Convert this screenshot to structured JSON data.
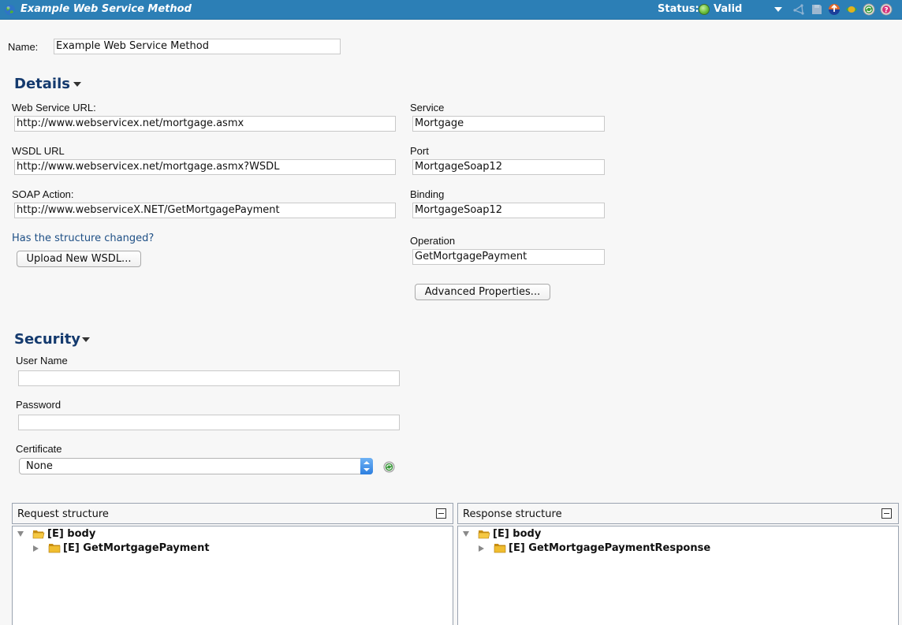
{
  "titlebar": {
    "title": "Example Web Service Method",
    "status_label": "Status:",
    "status_value": "Valid",
    "status_color": "#6cbf3c",
    "icons": [
      "globe-icon",
      "dropdown-arrow-icon",
      "share-icon",
      "save-icon",
      "deploy-icon",
      "toggle-icon",
      "refresh-icon",
      "help-icon"
    ]
  },
  "name": {
    "label": "Name:",
    "value": "Example Web Service Method"
  },
  "details": {
    "title": "Details",
    "web_service_url": {
      "label": "Web Service URL:",
      "value": "http://www.webservicex.net/mortgage.asmx"
    },
    "wsdl_url": {
      "label": "WSDL URL",
      "value": "http://www.webservicex.net/mortgage.asmx?WSDL"
    },
    "soap_action": {
      "label": "SOAP Action:",
      "value": "http://www.webserviceX.NET/GetMortgagePayment"
    },
    "structure_link": "Has the structure changed?",
    "upload_button": "Upload New WSDL...",
    "service": {
      "label": "Service",
      "value": "Mortgage"
    },
    "port": {
      "label": "Port",
      "value": "MortgageSoap12"
    },
    "binding": {
      "label": "Binding",
      "value": "MortgageSoap12"
    },
    "operation": {
      "label": "Operation",
      "value": "GetMortgagePayment"
    },
    "advanced_button": "Advanced Properties..."
  },
  "security": {
    "title": "Security",
    "user_name": {
      "label": "User Name",
      "value": ""
    },
    "password": {
      "label": "Password",
      "value": ""
    },
    "certificate": {
      "label": "Certificate",
      "selected": "None"
    }
  },
  "request": {
    "title": "Request structure",
    "tree": [
      {
        "label": "[E] body",
        "expanded": true,
        "level": 0
      },
      {
        "label": "[E] GetMortgagePayment",
        "expanded": false,
        "level": 1
      }
    ]
  },
  "response": {
    "title": "Response structure",
    "tree": [
      {
        "label": "[E] body",
        "expanded": true,
        "level": 0
      },
      {
        "label": "[E] GetMortgagePaymentResponse",
        "expanded": false,
        "level": 1
      }
    ]
  }
}
